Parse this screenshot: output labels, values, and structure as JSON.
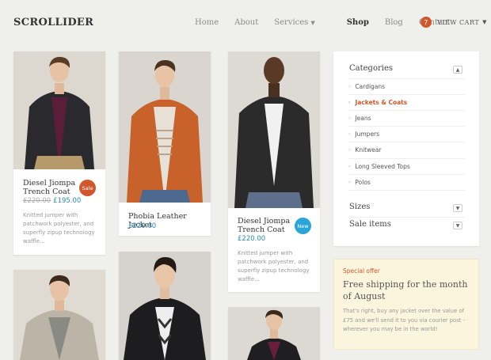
{
  "header": {
    "logo": "SCROLLIDER",
    "nav": [
      "Home",
      "About",
      "Services",
      "Shop",
      "Blog",
      "Contact"
    ],
    "active_nav": "Shop",
    "cart_count": "7",
    "cart_label": "VIEW CART"
  },
  "products": [
    {
      "title_1": "Diesel Jiompa",
      "title_2": "Trench Coat",
      "old_price": "£220.00",
      "price": "£195.00",
      "badge": "Sale",
      "desc_1": "Knitted jumper with",
      "desc_2": "patchwork polyester, and",
      "desc_3": "superfly zipup technology",
      "desc_4": "waffle..."
    },
    {
      "title_1": "Phobia Leather Jacket",
      "price": "£220.00"
    },
    {
      "title_1": "Diesel Jiompa",
      "title_2": "Trench Coat",
      "price": "£220.00",
      "badge": "New",
      "desc_1": "Knitted jumper with",
      "desc_2": "patchwork polyester, and",
      "desc_3": "superfly zipup technology",
      "desc_4": "waffle..."
    }
  ],
  "sidebar": {
    "categories_title": "Categories",
    "categories": [
      "Cardigans",
      "Jackets & Coats",
      "Jeans",
      "Jumpers",
      "Knitwear",
      "Long Sleeved Tops",
      "Polos"
    ],
    "active_category": "Jackets & Coats",
    "sizes_title": "Sizes",
    "sale_title": "Sale items"
  },
  "offer": {
    "label": "Special offer",
    "title": "Free shipping for the month of August",
    "body": "That's right, buy any jacket over the value of £75 and we'll send it to you via courier post - wherever you may be in the world!"
  },
  "colors": {
    "accent": "#d0582d",
    "price": "#2d8ab0",
    "new_badge": "#2ba5d8",
    "offer_bg": "#fbf5dd"
  }
}
